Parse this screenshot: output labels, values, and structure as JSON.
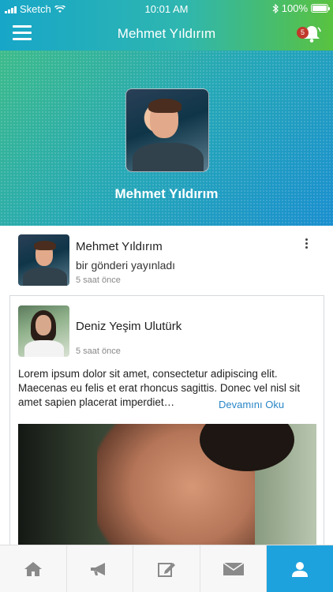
{
  "status_bar": {
    "carrier": "Sketch",
    "time": "10:01 AM",
    "battery": "100%"
  },
  "nav": {
    "title": "Mehmet Yıldırım",
    "notification_count": "5"
  },
  "profile": {
    "name": "Mehmet Yıldırım"
  },
  "feed": {
    "activity": {
      "author": "Mehmet Yıldırım",
      "action": "bir gönderi yayınladı",
      "time": "5 saat önce"
    },
    "shared_post": {
      "author": "Deniz Yeşim Ulutürk",
      "time": "5 saat önce",
      "text": "Lorem ipsum dolor sit amet, consectetur adipiscing elit. Maecenas eu felis et erat rhoncus sagittis. Donec vel nisl sit amet sapien placerat imperdiet…",
      "read_more": "Devamını Oku"
    }
  },
  "tabbar": {
    "tabs": [
      {
        "icon": "home-icon"
      },
      {
        "icon": "megaphone-icon"
      },
      {
        "icon": "edit-icon"
      },
      {
        "icon": "mail-icon"
      },
      {
        "icon": "profile-icon",
        "active": true
      }
    ]
  },
  "colors": {
    "accent": "#1ea2dd",
    "badge": "#c0392b",
    "link": "#2a86c7"
  }
}
